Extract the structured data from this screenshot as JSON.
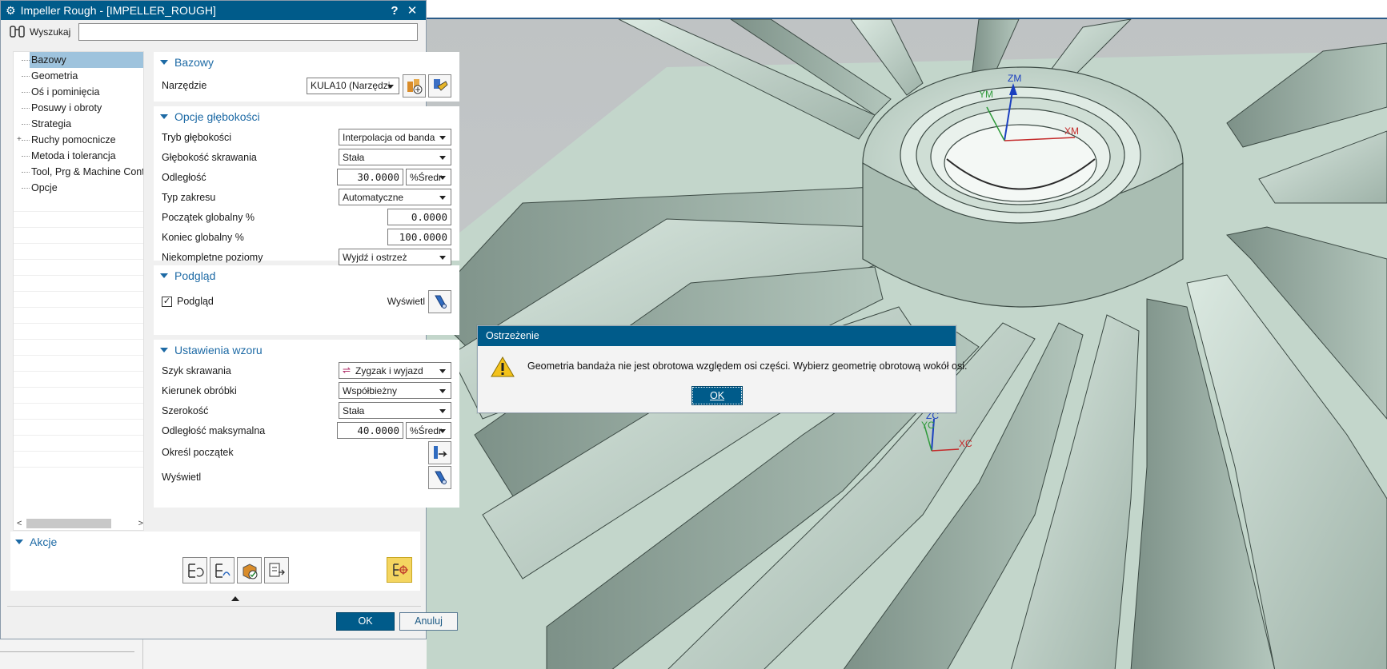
{
  "window": {
    "title": "Impeller Rough - [IMPELLER_ROUGH]",
    "help_glyph": "?",
    "close_glyph": "✕"
  },
  "search": {
    "label": "Wyszukaj",
    "value": "",
    "placeholder": ""
  },
  "tree": {
    "items": [
      {
        "label": "Bazowy",
        "selected": true
      },
      {
        "label": "Geometria"
      },
      {
        "label": "Oś i pominięcia"
      },
      {
        "label": "Posuwy i obroty"
      },
      {
        "label": "Strategia"
      },
      {
        "label": "Ruchy pomocnicze",
        "expandable": true
      },
      {
        "label": "Metoda i tolerancja"
      },
      {
        "label": "Tool, Prg & Machine Contr"
      },
      {
        "label": "Opcje"
      }
    ],
    "scroll_left": "<",
    "scroll_right": ">"
  },
  "groups": {
    "bazowy": {
      "title": "Bazowy",
      "narzedzie_label": "Narzędzie",
      "narzedzie_value": "KULA10 (Narzędzi"
    },
    "glebokosc": {
      "title": "Opcje głębokości",
      "tryb_label": "Tryb głębokości",
      "tryb_value": "Interpolacja od banda",
      "gleb_skr_label": "Głębokość skrawania",
      "gleb_skr_value": "Stała",
      "odleglosc_label": "Odległość",
      "odleglosc_value": "30.0000",
      "odleglosc_unit": "%Średr",
      "typ_label": "Typ zakresu",
      "typ_value": "Automatyczne",
      "poczatek_label": "Początek globalny %",
      "poczatek_value": "0.0000",
      "koniec_label": "Koniec globalny %",
      "koniec_value": "100.0000",
      "niekompletne_label": "Niekompletne poziomy",
      "niekompletne_value": "Wyjdź i ostrzeż"
    },
    "podglad": {
      "title": "Podgląd",
      "check_label": "Podgląd",
      "checked": true,
      "wyswietl_label": "Wyświetl"
    },
    "wzor": {
      "title": "Ustawienia wzoru",
      "szyk_label": "Szyk skrawania",
      "szyk_value": "Zygzak i wyjazd",
      "kierunek_label": "Kierunek obróbki",
      "kierunek_value": "Współbieżny",
      "szerokosc_label": "Szerokość",
      "szerokosc_value": "Stała",
      "odl_max_label": "Odległość maksymalna",
      "odl_max_value": "40.0000",
      "odl_max_unit": "%Średr",
      "okresl_label": "Określ początek",
      "wyswietl_label": "Wyświetl"
    }
  },
  "akcje": {
    "title": "Akcje"
  },
  "buttons": {
    "ok": "OK",
    "cancel": "Anuluj"
  },
  "warning": {
    "title": "Ostrzeżenie",
    "message": "Geometria bandaża nie jest obrotowa względem osi części. Wybierz geometrię obrotową wokół osi.",
    "ok": "OK"
  },
  "viewport": {
    "axes_top": {
      "x": "XM",
      "y": "YM",
      "z": "ZM"
    },
    "axes_bottom": {
      "x": "XC",
      "y": "YC",
      "z": "ZC"
    }
  },
  "colors": {
    "titlebar": "#005b8a",
    "accent": "#1d6aa5",
    "model": "#c9dcd2"
  }
}
